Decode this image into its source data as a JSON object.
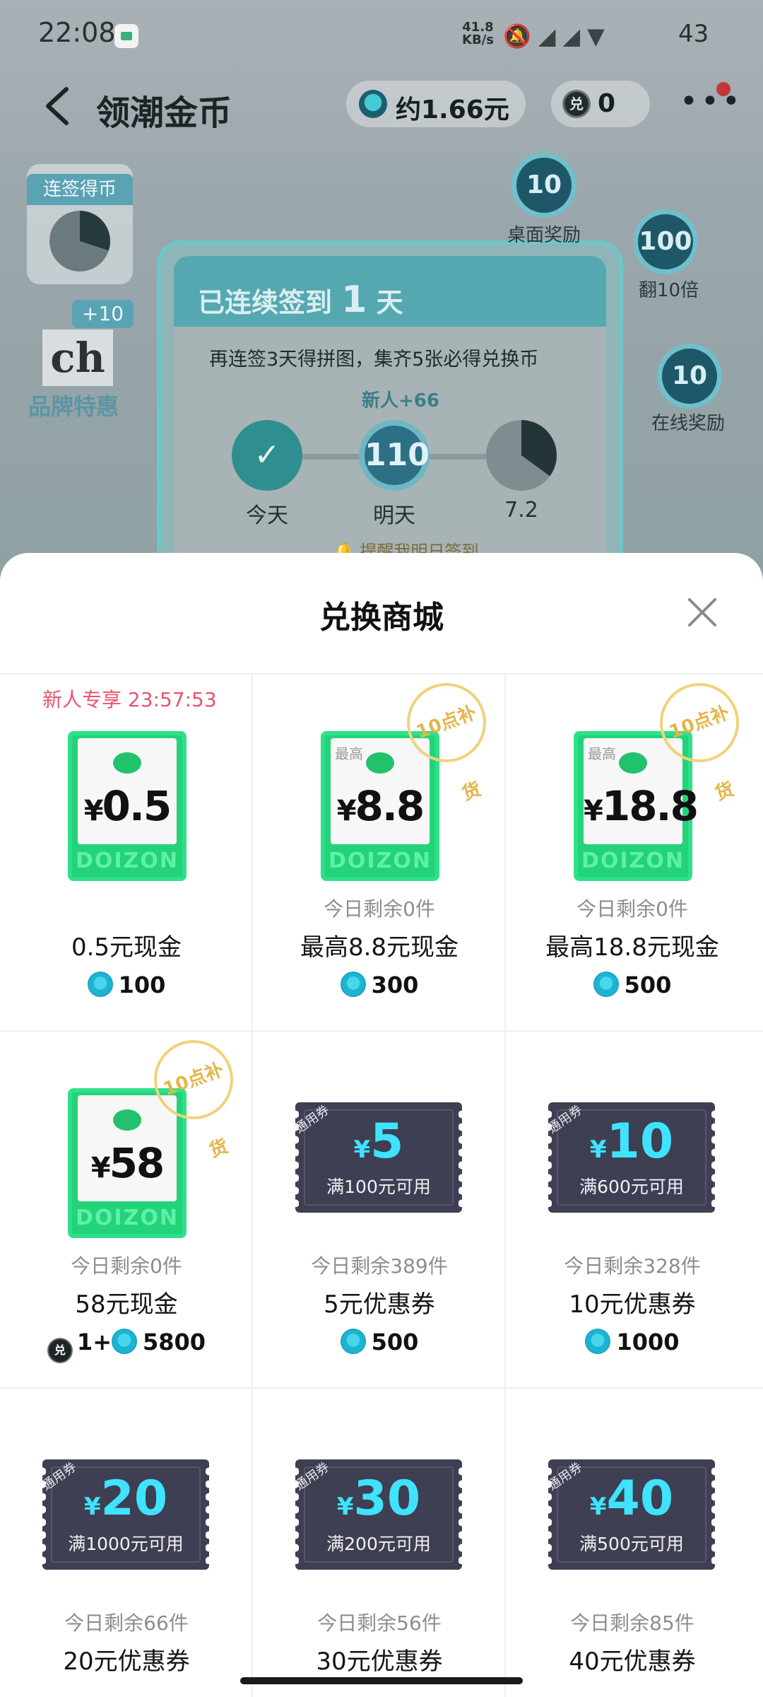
{
  "status_bar": {
    "time": "22:08",
    "speed_value": "41.8",
    "speed_unit": "KB/s",
    "battery": "43",
    "icons": [
      "app-notification-icon",
      "mute-icon",
      "signal-icon",
      "signal-icon",
      "wifi-icon",
      "battery-icon"
    ]
  },
  "header": {
    "title": "领潮金币",
    "coin_balance": "约1.66元",
    "exchange_coin_balance": "0"
  },
  "background": {
    "streak_badge": "连签得币",
    "brand_plus": "+10",
    "brand_logo": "ch",
    "brand_label": "品牌特惠",
    "checkin_title_pre": "已连续签到",
    "checkin_title_num": "1",
    "checkin_title_post": "天",
    "checkin_sub": "再连签3天得拼图，集齐5张必得兑换币",
    "newbie_tag": "新人+66",
    "days": [
      {
        "label": "今天",
        "value": "✓"
      },
      {
        "label": "明天",
        "value": "110"
      },
      {
        "label": "7.2",
        "value": ""
      }
    ],
    "remind": "🔔 提醒我明日签到",
    "rewards": [
      {
        "value": "10",
        "label": "桌面奖励"
      },
      {
        "value": "100",
        "label": "翻10倍"
      },
      {
        "value": "10",
        "label": "在线奖励"
      }
    ]
  },
  "sheet": {
    "title": "兑换商城",
    "items": [
      {
        "type": "cash",
        "timer": "新人专享 23:57:53",
        "max_label": "",
        "amount": "0.5",
        "stamp": "",
        "remain": "",
        "name": "0.5元现金",
        "price_exch": "",
        "price_coin": "100"
      },
      {
        "type": "cash",
        "timer": "",
        "max_label": "最高",
        "amount": "8.8",
        "stamp": "10点补货",
        "remain": "今日剩余0件",
        "name": "最高8.8元现金",
        "price_exch": "",
        "price_coin": "300"
      },
      {
        "type": "cash",
        "timer": "",
        "max_label": "最高",
        "amount": "18.8",
        "stamp": "10点补货",
        "remain": "今日剩余0件",
        "name": "最高18.8元现金",
        "price_exch": "",
        "price_coin": "500"
      },
      {
        "type": "cash",
        "timer": "",
        "max_label": "",
        "amount": "58",
        "stamp": "10点补货",
        "remain": "今日剩余0件",
        "name": "58元现金",
        "price_exch": "1+",
        "price_coin": "5800"
      },
      {
        "type": "coupon",
        "tag": "通用券",
        "amount": "5",
        "condition": "满100元可用",
        "remain": "今日剩余389件",
        "name": "5元优惠券",
        "price_coin": "500"
      },
      {
        "type": "coupon",
        "tag": "通用券",
        "amount": "10",
        "condition": "满600元可用",
        "remain": "今日剩余328件",
        "name": "10元优惠券",
        "price_coin": "1000"
      },
      {
        "type": "coupon",
        "tag": "通用券",
        "amount": "20",
        "condition": "满1000元可用",
        "remain": "今日剩余66件",
        "name": "20元优惠券",
        "price_coin": ""
      },
      {
        "type": "coupon",
        "tag": "通用券",
        "amount": "30",
        "condition": "满200元可用",
        "remain": "今日剩余56件",
        "name": "30元优惠券",
        "price_coin": ""
      },
      {
        "type": "coupon",
        "tag": "通用券",
        "amount": "40",
        "condition": "满500元可用",
        "remain": "今日剩余85件",
        "name": "40元优惠券",
        "price_coin": ""
      }
    ],
    "cash_brand_strip": "DOIZON",
    "yen": "¥"
  },
  "colors": {
    "accent_teal": "#3fe3ff",
    "cash_green": "#23d37a",
    "timer_red": "#e9546b",
    "coupon_dark": "#3e3f52",
    "stamp_gold": "#e3b64a"
  }
}
